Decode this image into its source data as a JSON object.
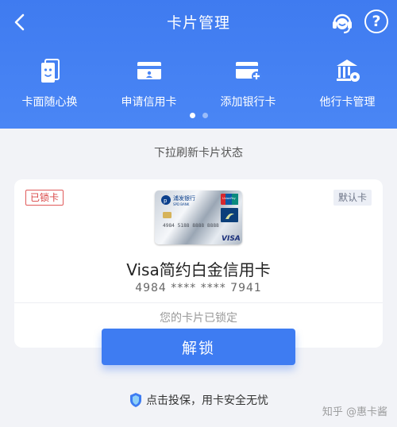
{
  "header": {
    "title": "卡片管理",
    "icons": {
      "back": "chevron-left-icon",
      "service": "customer-service-icon",
      "help": "help-icon"
    },
    "help_label": "?",
    "actions": [
      {
        "label": "卡面随心换",
        "icon": "card-face-icon"
      },
      {
        "label": "申请信用卡",
        "icon": "credit-card-apply-icon"
      },
      {
        "label": "添加银行卡",
        "icon": "add-card-icon"
      },
      {
        "label": "他行卡管理",
        "icon": "bank-gear-icon"
      }
    ],
    "pager": {
      "pages": 2,
      "current": 1
    }
  },
  "refresh_tip": "下拉刷新卡片状态",
  "card": {
    "status_badge": "已锁卡",
    "default_badge": "默认卡",
    "name": "Visa简约白金信用卡",
    "number": "4984 **** **** 7941",
    "lock_status": "您的卡片已锁定",
    "image": {
      "bank_name_cn": "浦发银行",
      "bank_name_en": "SPD BANK",
      "number_print": "4984 5188 8888 8888",
      "network": "VISA",
      "unionpay_label": "UnionPay"
    }
  },
  "unlock_button": "解锁",
  "insure_text": "点击投保，用卡安全无忧",
  "watermark": "知乎 @惠卡酱",
  "colors": {
    "primary": "#3e7cf2",
    "header": "#4a86f5",
    "locked": "#d94545",
    "background": "#f2f3f7"
  }
}
